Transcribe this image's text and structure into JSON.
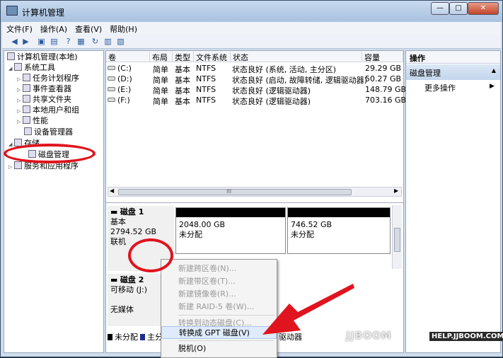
{
  "window": {
    "title": "计算机管理",
    "buttons": {
      "minimize": "—",
      "maximize": "□",
      "close": "✕"
    }
  },
  "menu": [
    "文件(F)",
    "操作(A)",
    "查看(V)",
    "帮助(H)"
  ],
  "tree": {
    "root": "计算机管理(本地)",
    "system_tools": "系统工具",
    "task_scheduler": "任务计划程序",
    "event_viewer": "事件查看器",
    "shared_folders": "共享文件夹",
    "local_users": "本地用户和组",
    "performance": "性能",
    "device_manager": "设备管理器",
    "storage": "存储",
    "disk_management": "磁盘管理",
    "services_apps": "服务和应用程序"
  },
  "volumes": {
    "headers": [
      "卷",
      "布局",
      "类型",
      "文件系统",
      "状态",
      "容量"
    ],
    "rows": [
      [
        "(C:)",
        "简单",
        "基本",
        "NTFS",
        "状态良好 (系统, 活动, 主分区)",
        "29.29 GB"
      ],
      [
        "(D:)",
        "简单",
        "基本",
        "NTFS",
        "状态良好 (启动, 故障转储, 逻辑驱动器)",
        "50.27 GB"
      ],
      [
        "(E:)",
        "简单",
        "基本",
        "NTFS",
        "状态良好 (逻辑驱动器)",
        "148.79 GB"
      ],
      [
        "(F:)",
        "简单",
        "基本",
        "NTFS",
        "状态良好 (逻辑驱动器)",
        "703.16 GB"
      ]
    ],
    "scroll_label": "III"
  },
  "disks": {
    "disk1": {
      "name": "磁盘 1",
      "type": "基本",
      "size": "2794.52 GB",
      "status": "联机",
      "partitions": [
        {
          "size": "2048.00 GB",
          "state": "未分配"
        },
        {
          "size": "746.52 GB",
          "state": "未分配"
        }
      ]
    },
    "disk2": {
      "name": "磁盘 2",
      "type": "可移动 (J:)",
      "status": "无媒体"
    },
    "legend": [
      "未分配",
      "主分",
      "驱动器"
    ]
  },
  "actions": {
    "header": "操作",
    "section": "磁盘管理",
    "more": "更多操作"
  },
  "context_menu": [
    {
      "label": "新建跨区卷(N)...",
      "enabled": false
    },
    {
      "label": "新建带区卷(T)...",
      "enabled": false
    },
    {
      "label": "新建镜像卷(R)...",
      "enabled": false
    },
    {
      "label": "新建 RAID-5 卷(W)...",
      "enabled": false
    },
    {
      "label": "转换到动态磁盘(C)...",
      "enabled": false
    },
    {
      "label": "转换成 GPT 磁盘(V)",
      "enabled": true
    },
    {
      "label": "脱机(O)",
      "enabled": true
    }
  ],
  "watermark": {
    "brand": "JJBOOM",
    "site": "HELP.JJBOOM.COM"
  },
  "colors": {
    "highlight": "#dfeafa",
    "annotation": "#e0141e",
    "unallocated": "#000000",
    "primary": "#1f2f8f"
  }
}
